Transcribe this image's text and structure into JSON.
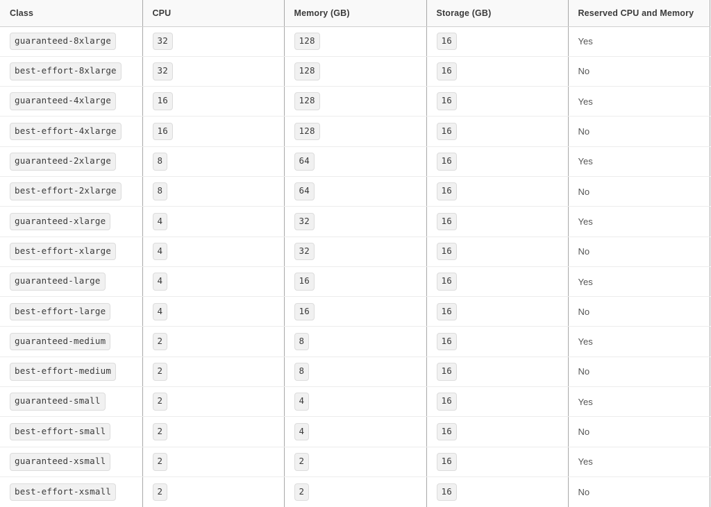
{
  "table": {
    "name": "compute-class-specifications",
    "columns": [
      {
        "key": "class",
        "label": "Class",
        "cell_style": "chip"
      },
      {
        "key": "cpu",
        "label": "CPU",
        "cell_style": "chip"
      },
      {
        "key": "memory",
        "label": "Memory (GB)",
        "cell_style": "chip"
      },
      {
        "key": "storage",
        "label": "Storage (GB)",
        "cell_style": "chip"
      },
      {
        "key": "reserved",
        "label": "Reserved CPU and Memory",
        "cell_style": "plain"
      }
    ],
    "rows": [
      {
        "class": "guaranteed-8xlarge",
        "cpu": "32",
        "memory": "128",
        "storage": "16",
        "reserved": "Yes"
      },
      {
        "class": "best-effort-8xlarge",
        "cpu": "32",
        "memory": "128",
        "storage": "16",
        "reserved": "No"
      },
      {
        "class": "guaranteed-4xlarge",
        "cpu": "16",
        "memory": "128",
        "storage": "16",
        "reserved": "Yes"
      },
      {
        "class": "best-effort-4xlarge",
        "cpu": "16",
        "memory": "128",
        "storage": "16",
        "reserved": "No"
      },
      {
        "class": "guaranteed-2xlarge",
        "cpu": "8",
        "memory": "64",
        "storage": "16",
        "reserved": "Yes"
      },
      {
        "class": "best-effort-2xlarge",
        "cpu": "8",
        "memory": "64",
        "storage": "16",
        "reserved": "No"
      },
      {
        "class": "guaranteed-xlarge",
        "cpu": "4",
        "memory": "32",
        "storage": "16",
        "reserved": "Yes"
      },
      {
        "class": "best-effort-xlarge",
        "cpu": "4",
        "memory": "32",
        "storage": "16",
        "reserved": "No"
      },
      {
        "class": "guaranteed-large",
        "cpu": "4",
        "memory": "16",
        "storage": "16",
        "reserved": "Yes"
      },
      {
        "class": "best-effort-large",
        "cpu": "4",
        "memory": "16",
        "storage": "16",
        "reserved": "No"
      },
      {
        "class": "guaranteed-medium",
        "cpu": "2",
        "memory": "8",
        "storage": "16",
        "reserved": "Yes"
      },
      {
        "class": "best-effort-medium",
        "cpu": "2",
        "memory": "8",
        "storage": "16",
        "reserved": "No"
      },
      {
        "class": "guaranteed-small",
        "cpu": "2",
        "memory": "4",
        "storage": "16",
        "reserved": "Yes"
      },
      {
        "class": "best-effort-small",
        "cpu": "2",
        "memory": "4",
        "storage": "16",
        "reserved": "No"
      },
      {
        "class": "guaranteed-xsmall",
        "cpu": "2",
        "memory": "2",
        "storage": "16",
        "reserved": "Yes"
      },
      {
        "class": "best-effort-xsmall",
        "cpu": "2",
        "memory": "2",
        "storage": "16",
        "reserved": "No"
      }
    ]
  },
  "colors": {
    "header_background": "#f9f9f9",
    "header_text": "#3b3b3b",
    "body_text": "#555555",
    "chip_background": "#f1f1f1",
    "chip_border": "#dcdcdc",
    "chip_text": "#3a3a3a",
    "column_divider": "#a8a8a8",
    "row_divider": "#ececec",
    "page_background": "#ffffff"
  }
}
